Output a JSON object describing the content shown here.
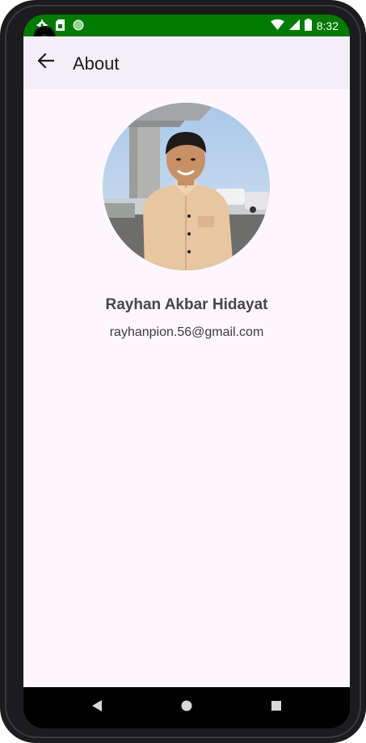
{
  "status_bar": {
    "time": "8:32",
    "icons": [
      "settings-icon",
      "sim-card-icon",
      "circle-indicator-icon",
      "wifi-icon",
      "signal-icon",
      "battery-icon"
    ],
    "background_color": "#007a00"
  },
  "app_bar": {
    "title": "About",
    "back_icon": "arrow-back-icon"
  },
  "profile": {
    "name": "Rayhan Akbar Hidayat",
    "email": "rayhanpion.56@gmail.com",
    "photo": "profile-photo"
  },
  "nav_bar": {
    "items": [
      "back-triangle-icon",
      "home-circle-icon",
      "recents-square-icon"
    ]
  },
  "colors": {
    "app_bar_bg": "#f3eff6",
    "content_bg": "#fdf7fd",
    "name_text": "#48454e"
  }
}
